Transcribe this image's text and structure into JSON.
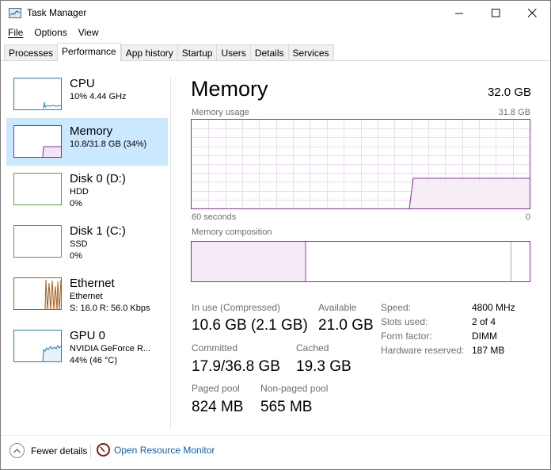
{
  "window": {
    "title": "Task Manager",
    "minimize": "—",
    "maximize": "☐",
    "close": "✕"
  },
  "menu": {
    "file": "File",
    "options": "Options",
    "view": "View"
  },
  "tabs": [
    "Processes",
    "Performance",
    "App history",
    "Startup",
    "Users",
    "Details",
    "Services"
  ],
  "active_tab": "Performance",
  "resources": [
    {
      "name": "CPU",
      "line1": "10% 4.44 GHz",
      "line2": "",
      "color": "#1e7fb4"
    },
    {
      "name": "Memory",
      "line1": "10.8/31.8 GB (34%)",
      "line2": "",
      "color": "#8b2aa0"
    },
    {
      "name": "Disk 0 (D:)",
      "line1": "HDD",
      "line2": "0%",
      "color": "#4ea72e"
    },
    {
      "name": "Disk 1 (C:)",
      "line1": "SSD",
      "line2": "0%",
      "color": "#4ea72e"
    },
    {
      "name": "Ethernet",
      "line1": "Ethernet",
      "line2": "S: 16.0 R: 56.0 Kbps",
      "color": "#a7601d"
    },
    {
      "name": "GPU 0",
      "line1": "NVIDIA GeForce R...",
      "line2": "44% (46 °C)",
      "color": "#1e7fb4"
    }
  ],
  "memory": {
    "title": "Memory",
    "total": "32.0 GB",
    "usage_label": "Memory usage",
    "usage_max": "31.8 GB",
    "x_left": "60 seconds",
    "x_right": "0",
    "composition_label": "Memory composition",
    "in_use_fraction": 0.34,
    "stats": {
      "in_use_label": "In use (Compressed)",
      "in_use_value": "10.6 GB (2.1 GB)",
      "available_label": "Available",
      "available_value": "21.0 GB",
      "committed_label": "Committed",
      "committed_value": "17.9/36.8 GB",
      "cached_label": "Cached",
      "cached_value": "19.3 GB",
      "paged_label": "Paged pool",
      "paged_value": "824 MB",
      "nonpaged_label": "Non-paged pool",
      "nonpaged_value": "565 MB"
    },
    "details": [
      {
        "k": "Speed:",
        "v": "4800 MHz"
      },
      {
        "k": "Slots used:",
        "v": "2 of 4"
      },
      {
        "k": "Form factor:",
        "v": "DIMM"
      },
      {
        "k": "Hardware reserved:",
        "v": "187 MB"
      }
    ]
  },
  "footer": {
    "fewer_details": "Fewer details",
    "open_resource_monitor": "Open Resource Monitor"
  },
  "colors": {
    "memory": "#8b2aa0",
    "memory_fill": "#f4eaf5",
    "selected_bg": "#cce8ff",
    "link": "#0b61a4"
  }
}
